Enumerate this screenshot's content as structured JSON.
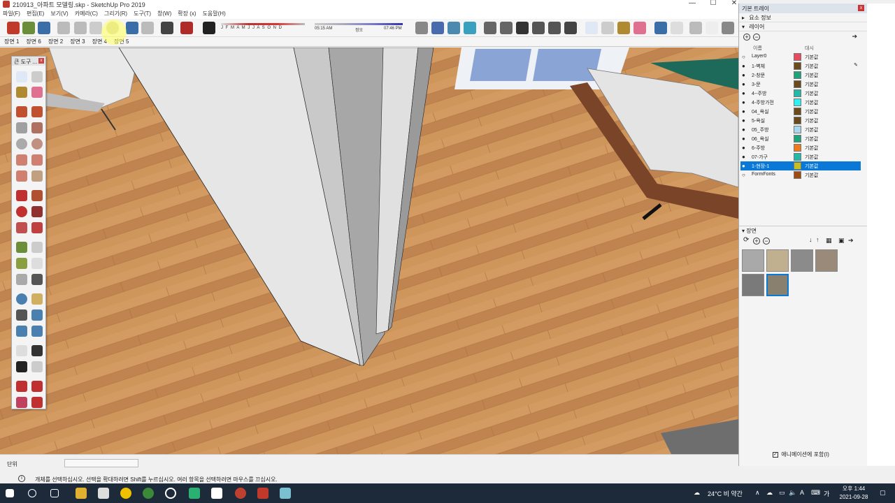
{
  "window": {
    "title": "210913_아파트 모델링.skp - SketchUp Pro 2019",
    "minimize": "—",
    "maximize": "☐",
    "close": "✕"
  },
  "menu": [
    "파일(F)",
    "편집(E)",
    "보기(V)",
    "카메라(C)",
    "그리기(R)",
    "도구(T)",
    "창(W)",
    "확장 (x)",
    "도움말(H)"
  ],
  "shadow": {
    "months": "J F M A M J J A S O N D",
    "time_start": "05:15 AM",
    "time_noon": "정오",
    "time_end": "07:46 PM"
  },
  "scene_tabs": [
    "장면 1",
    "장면 6",
    "장면 2",
    "장면 3",
    "장면 4",
    "장면 5"
  ],
  "palette": {
    "title": "큰 도구 ...",
    "close": "x"
  },
  "status": {
    "unit_label": "단위",
    "hint": "개체를 선택하십시오. 선택을 확대하려면 Shift를 누르십시오. 여러 항목을 선택하려면 마우스를 끄십시오."
  },
  "tray": {
    "title": "기본 트레이",
    "close": "x",
    "entity_info": "요소 정보",
    "layers_section": "레이어",
    "col_name": "이름",
    "col_dash": "대시",
    "layers": [
      {
        "name": "Layer0",
        "color": "#e84a5f",
        "dash": "기본값",
        "visible": false
      },
      {
        "name": "1-벽체",
        "color": "#6b4a1c",
        "dash": "기본값",
        "visible": true
      },
      {
        "name": "2-창문",
        "color": "#1fa37a",
        "dash": "기본값",
        "visible": true
      },
      {
        "name": "3-문",
        "color": "#6b4a1c",
        "dash": "기본값",
        "visible": true
      },
      {
        "name": "4--주방",
        "color": "#23b8a8",
        "dash": "기본값",
        "visible": true
      },
      {
        "name": "4-주방가전",
        "color": "#2ef0f0",
        "dash": "기본값",
        "visible": true
      },
      {
        "name": "04_욕실",
        "color": "#6b4a1c",
        "dash": "기본값",
        "visible": true
      },
      {
        "name": "5-욕실",
        "color": "#6b4a1c",
        "dash": "기본값",
        "visible": true
      },
      {
        "name": "05_주방",
        "color": "#a8d8f0",
        "dash": "기본값",
        "visible": true
      },
      {
        "name": "06_욕실",
        "color": "#1fa37a",
        "dash": "기본값",
        "visible": true
      },
      {
        "name": "6-주방",
        "color": "#f07a1a",
        "dash": "기본값",
        "visible": true
      },
      {
        "name": "07-가구",
        "color": "#23b8a8",
        "dash": "기본값",
        "visible": true
      },
      {
        "name": "1-현장-1",
        "color": "#c8c020",
        "dash": "기본값",
        "visible": true,
        "selected": true
      },
      {
        "name": "FormFonts",
        "color": "#a04a14",
        "dash": "기본값",
        "visible": false
      }
    ],
    "scenes_section": "장면",
    "anim_label": "애니메이션에 포함(I)"
  },
  "taskbar": {
    "weather": "24°C 비 약간",
    "ime": "A",
    "ime2": "가",
    "time": "오후 1:44",
    "date": "2021-09-28"
  },
  "colors": {
    "floor": "#c98d55",
    "wall": "#e6e6e6",
    "selection": "#0a78d7"
  }
}
